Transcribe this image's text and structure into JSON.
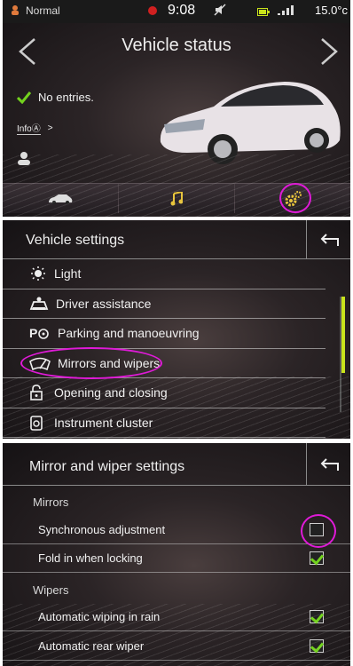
{
  "status_bar": {
    "profile": "Normal",
    "time": "9:08",
    "temperature": "15.0°c",
    "icons": [
      "profile-icon",
      "record-icon",
      "mute-icon",
      "battery-icon",
      "signal-icon"
    ]
  },
  "vehicle_status": {
    "title": "Vehicle status",
    "no_entries": "No entries.",
    "info_label": "Info",
    "tabs": [
      "car-tab-icon",
      "music-tab-icon",
      "settings-gear-icon"
    ]
  },
  "vehicle_settings": {
    "title": "Vehicle settings",
    "items": [
      {
        "label": "Light",
        "icon": "light-icon"
      },
      {
        "label": "Driver assistance",
        "icon": "driver-assistance-icon"
      },
      {
        "label": "Parking and manoeuvring",
        "icon": "parking-icon"
      },
      {
        "label": "Mirrors and wipers",
        "icon": "mirror-wiper-icon"
      },
      {
        "label": "Opening and closing",
        "icon": "lock-icon"
      },
      {
        "label": "Instrument cluster",
        "icon": "instrument-icon"
      }
    ]
  },
  "mirror_wiper": {
    "title": "Mirror and wiper settings",
    "section_mirrors": "Mirrors",
    "section_wipers": "Wipers",
    "rows": [
      {
        "label": "Synchronous adjustment",
        "checked": false
      },
      {
        "label": "Fold in when locking",
        "checked": true
      },
      {
        "label": "Automatic wiping in rain",
        "checked": true
      },
      {
        "label": "Automatic rear wiper",
        "checked": true
      }
    ]
  },
  "colors": {
    "highlight": "#e01ad8",
    "check": "#73d21e",
    "scroll": "#c9e31b"
  }
}
